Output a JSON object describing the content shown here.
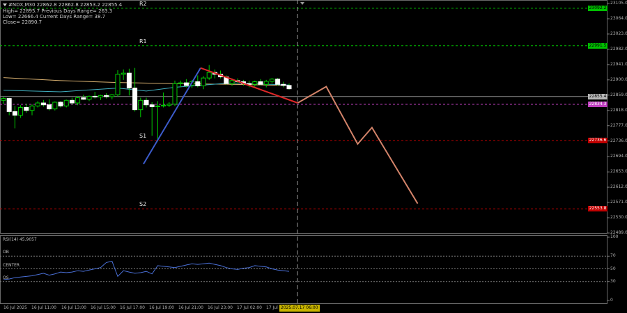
{
  "chart_data": {
    "type": "candlestick",
    "symbol_header": "#NDX,M30  22862.8 22862.8 22853.2 22855.4",
    "info_lines": [
      "High= 22895.7   Previous Days Range= 263.3",
      "Low= 22666.4   Current Days Range= 38.7",
      "Close= 22890.7"
    ],
    "price_axis": {
      "min": 22489.0,
      "max": 23105.0,
      "ticks": [
        "23105.0",
        "23064.0",
        "23023.0",
        "22982.0",
        "22941.0",
        "22900.0",
        "22859.0",
        "22818.0",
        "22777.0",
        "22736.0",
        "22694.0",
        "22653.0",
        "22612.0",
        "22571.0",
        "22530.0",
        "22489.0"
      ]
    },
    "time_axis": [
      "16 Jul 2025",
      "16 Jul 11:00",
      "16 Jul 13:00",
      "16 Jul 15:00",
      "16 Jul 17:00",
      "16 Jul 19:00",
      "16 Jul 21:00",
      "16 Jul 23:00",
      "17 Jul 02:00",
      "17 Jul",
      "2025.07.17 06:00"
    ],
    "pivots": [
      {
        "label": "R2",
        "price": 23092.2,
        "color": "#00c000",
        "badge": "23092.2"
      },
      {
        "label": "R1",
        "price": 22991.5,
        "color": "#00c000",
        "badge": "22991.5"
      },
      {
        "label": "S1",
        "price": 22736.6,
        "color": "#c00000",
        "badge": "22736.6"
      },
      {
        "label": "S2",
        "price": 22553.8,
        "color": "#c00000",
        "badge": "22553.8"
      }
    ],
    "current_price": {
      "value": 22855.4,
      "badge": "22855.4"
    },
    "purple_level": {
      "value": 22834.3,
      "badge": "22834.3"
    },
    "candles": [
      [
        0,
        22845,
        22855,
        22835,
        22850
      ],
      [
        1,
        22850,
        22852,
        22805,
        22815
      ],
      [
        2,
        22815,
        22830,
        22770,
        22805
      ],
      [
        3,
        22805,
        22832,
        22798,
        22826
      ],
      [
        4,
        22826,
        22836,
        22812,
        22818
      ],
      [
        5,
        22818,
        22834,
        22805,
        22830
      ],
      [
        6,
        22830,
        22843,
        22826,
        22838
      ],
      [
        7,
        22838,
        22846,
        22828,
        22833
      ],
      [
        8,
        22833,
        22848,
        22818,
        22822
      ],
      [
        9,
        22822,
        22842,
        22818,
        22840
      ],
      [
        10,
        22840,
        22843,
        22826,
        22830
      ],
      [
        11,
        22830,
        22847,
        22826,
        22845
      ],
      [
        12,
        22845,
        22852,
        22834,
        22838
      ],
      [
        13,
        22838,
        22856,
        22832,
        22852
      ],
      [
        14,
        22852,
        22860,
        22846,
        22848
      ],
      [
        15,
        22848,
        22858,
        22843,
        22856
      ],
      [
        16,
        22856,
        22868,
        22850,
        22854
      ],
      [
        17,
        22854,
        22860,
        22846,
        22858
      ],
      [
        18,
        22858,
        22864,
        22850,
        22855
      ],
      [
        19,
        22855,
        22862,
        22848,
        22860
      ],
      [
        20,
        22860,
        22926,
        22855,
        22915
      ],
      [
        21,
        22915,
        22928,
        22900,
        22918
      ],
      [
        22,
        22918,
        22930,
        22858,
        22878
      ],
      [
        23,
        22878,
        22932,
        22815,
        22820
      ],
      [
        24,
        22820,
        22852,
        22800,
        22845
      ],
      [
        25,
        22845,
        22852,
        22826,
        22833
      ],
      [
        26,
        22833,
        22840,
        22750,
        22828
      ],
      [
        27,
        22828,
        22843,
        22735,
        22830
      ],
      [
        28,
        22830,
        22866,
        22826,
        22832
      ],
      [
        29,
        22832,
        22840,
        22827,
        22835
      ],
      [
        30,
        22835,
        22898,
        22830,
        22890
      ],
      [
        31,
        22890,
        22898,
        22880,
        22892
      ],
      [
        32,
        22892,
        22902,
        22880,
        22885
      ],
      [
        33,
        22885,
        22900,
        22878,
        22895
      ],
      [
        34,
        22895,
        22912,
        22880,
        22884
      ],
      [
        35,
        22884,
        22910,
        22875,
        22905
      ],
      [
        36,
        22905,
        22940,
        22900,
        22920
      ],
      [
        37,
        22920,
        22928,
        22904,
        22915
      ],
      [
        38,
        22915,
        22925,
        22904,
        22908
      ],
      [
        39,
        22908,
        22912,
        22887,
        22890
      ],
      [
        40,
        22890,
        22904,
        22884,
        22898
      ],
      [
        41,
        22898,
        22904,
        22890,
        22895
      ],
      [
        42,
        22895,
        22900,
        22885,
        22890
      ],
      [
        43,
        22890,
        22898,
        22880,
        22888
      ],
      [
        44,
        22888,
        22898,
        22882,
        22895
      ],
      [
        45,
        22895,
        22902,
        22886,
        22888
      ],
      [
        46,
        22888,
        22900,
        22880,
        22896
      ],
      [
        47,
        22896,
        22905,
        22890,
        22902
      ],
      [
        48,
        22902,
        22905,
        22885,
        22888
      ],
      [
        49,
        22888,
        22895,
        22880,
        22885
      ],
      [
        50,
        22885,
        22890,
        22874,
        22876
      ]
    ],
    "ma_slow": [
      [
        0,
        22906
      ],
      [
        10,
        22898
      ],
      [
        20,
        22893
      ],
      [
        30,
        22890
      ],
      [
        40,
        22888
      ],
      [
        50,
        22885
      ]
    ],
    "ma_fast": [
      [
        0,
        22872
      ],
      [
        10,
        22868
      ],
      [
        20,
        22878
      ],
      [
        25,
        22870
      ],
      [
        30,
        22880
      ],
      [
        40,
        22892
      ],
      [
        50,
        22886
      ]
    ],
    "wave_blue": [
      [
        24.5,
        22674
      ],
      [
        34.5,
        22932
      ]
    ],
    "wave_red": [
      [
        34.5,
        22932
      ],
      [
        51.5,
        22838
      ]
    ],
    "projection": [
      [
        51.5,
        22838
      ],
      [
        56.5,
        22882
      ],
      [
        62,
        22728
      ],
      [
        64.5,
        22772
      ],
      [
        72.5,
        22568
      ]
    ],
    "rsi": {
      "title": "RSI(14) 45.9057",
      "axis_ticks": [
        "100",
        "70",
        "50",
        "30",
        "0"
      ],
      "levels": [
        {
          "label": "OB",
          "value": 70
        },
        {
          "label": "CENTER",
          "value": 50
        },
        {
          "label": "OS",
          "value": 30
        }
      ],
      "values": [
        33,
        34,
        36,
        37,
        38,
        39,
        41,
        43,
        40,
        42,
        45,
        44,
        45,
        47,
        46,
        48,
        50,
        52,
        60,
        62,
        38,
        47,
        45,
        43,
        44,
        46,
        42,
        55,
        54,
        53,
        52,
        54,
        56,
        58,
        57,
        58,
        59,
        57,
        55,
        52,
        50,
        49,
        51,
        52,
        55,
        54,
        53,
        50,
        48,
        47,
        46
      ]
    }
  }
}
